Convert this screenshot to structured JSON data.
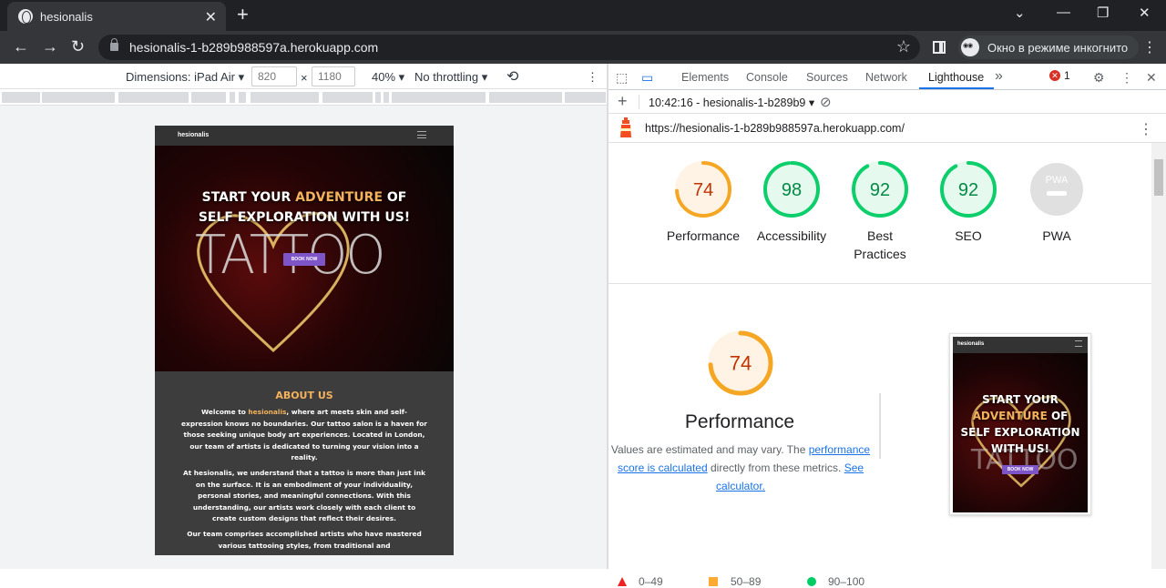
{
  "browser": {
    "tab_title": "hesionalis",
    "url": "hesionalis-1-b289b988597a.herokuapp.com",
    "incognito_label": "Окно в режиме инкогнито"
  },
  "device_toolbar": {
    "dimensions_label": "Dimensions: iPad Air",
    "width": "820",
    "height": "1180",
    "times": "×",
    "zoom": "40%",
    "throttling": "No throttling"
  },
  "site": {
    "brand": "hesionalis",
    "hero_line1_a": "START YOUR ",
    "hero_line1_accent": "ADVENTURE",
    "hero_line1_b": " OF",
    "hero_line2": "SELF EXPLORATION WITH US!",
    "tattoo_word": "TATTOO",
    "book_button": "BOOK NOW",
    "about_title": "ABOUT US",
    "about_p1_a": "Welcome to ",
    "about_p1_accent": "hesionalis",
    "about_p1_b": ", where art meets skin and self-expression knows no boundaries. Our tattoo salon is a haven for those seeking unique body art experiences. Located in London, our team of artists is dedicated to turning your vision into a reality.",
    "about_p2": "At hesionalis, we understand that a tattoo is more than just ink on the surface. It is an embodiment of your individuality, personal stories, and meaningful connections. With this understanding, our artists work closely with each client to create custom designs that reflect their desires.",
    "about_p3": "Our team comprises accomplished artists who have mastered various tattooing styles, from traditional and"
  },
  "devtools": {
    "tabs": [
      "Elements",
      "Console",
      "Sources",
      "Network",
      "Lighthouse"
    ],
    "more_tabs": "»",
    "error_count": "1",
    "report_time": "10:42:16 - hesionalis-1-b289b9",
    "audited_url": "https://hesionalis-1-b289b988597a.herokuapp.com/"
  },
  "lighthouse": {
    "gauges": [
      {
        "score": "74",
        "label": "Performance",
        "value": 74,
        "color": "#f5a623"
      },
      {
        "score": "98",
        "label": "Accessibility",
        "value": 98,
        "color": "#0cce6b"
      },
      {
        "score": "92",
        "label": "Best Practices",
        "value": 92,
        "color": "#0cce6b"
      },
      {
        "score": "92",
        "label": "SEO",
        "value": 92,
        "color": "#0cce6b"
      },
      {
        "score": "PWA",
        "label": "PWA",
        "value": 0,
        "color": "#9e9e9e"
      }
    ],
    "perf_score": "74",
    "perf_title": "Performance",
    "perf_desc_a": "Values are estimated and may vary. The ",
    "perf_desc_link1": "performance score is calculated",
    "perf_desc_b": " directly from these metrics. ",
    "perf_desc_link2": "See calculator.",
    "legend": {
      "fail": "0–49",
      "average": "50–89",
      "pass": "90–100"
    },
    "colors": {
      "pass": "#0cce6b",
      "average": "#ffa400",
      "fail": "#ff4e42",
      "link": "#1a73e8"
    }
  }
}
